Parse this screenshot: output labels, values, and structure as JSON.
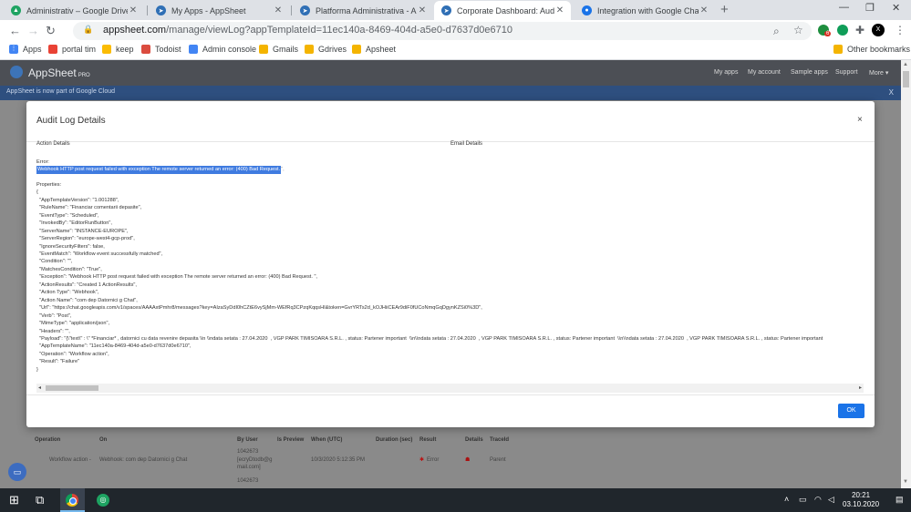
{
  "tabs": [
    {
      "title": "Administrativ – Google Drive",
      "icon": "google-drive-icon",
      "color": "#1fa463"
    },
    {
      "title": "My Apps - AppSheet",
      "icon": "appsheet-icon",
      "color": "#2f6fb5"
    },
    {
      "title": "Platforma Administrativa - AppSh",
      "icon": "appsheet-icon",
      "color": "#2f6fb5"
    },
    {
      "title": "Corporate Dashboard: Audit Log",
      "icon": "appsheet-icon",
      "color": "#2f6fb5"
    },
    {
      "title": "Integration with Google Chat - H",
      "icon": "chat-icon",
      "color": "#1a73e8"
    }
  ],
  "toolbar": {
    "url_host": "appsheet.com",
    "url_path": "/manage/viewLog?appTemplateId=11ec140a-8469-404d-a5e0-d7637d0e6710",
    "ext_badge": "6"
  },
  "bookmarks": [
    {
      "label": "Apps",
      "color": "#4285f4"
    },
    {
      "label": "portal tim",
      "color": "#e94235"
    },
    {
      "label": "keep",
      "color": "#fbbc04"
    },
    {
      "label": "Todoist",
      "color": "#db4c3f"
    },
    {
      "label": "Admin console",
      "color": "#4285f4"
    },
    {
      "label": "Gmails",
      "color": "#f4b400"
    },
    {
      "label": "Gdrives",
      "color": "#f4b400"
    },
    {
      "label": "Apsheet",
      "color": "#f4b400"
    },
    {
      "label": "Other bookmarks",
      "color": "#f4b400"
    }
  ],
  "app": {
    "brand": "AppSheet",
    "brand_suffix": "PRO",
    "nav": [
      "My apps",
      "My account",
      "Sample apps",
      "Support",
      "More ▾"
    ],
    "banner": "AppSheet is now part of Google Cloud",
    "banner_close": "X"
  },
  "bgtable": {
    "headers": [
      "Operation",
      "On",
      "By User",
      "Is Preview",
      "When (UTC)",
      "Duration (sec)",
      "Result",
      "Details",
      "TraceId"
    ],
    "row": {
      "operation": "Workflow action -",
      "on": "Webhook: com dep Datornici g Chat",
      "user_id": "1042673",
      "user_email": "[ecryDtodb@g",
      "user_email2": "mail.com]",
      "when": "10/3/2020 5:12:35 PM",
      "result": "Error",
      "traceid": "Parent"
    },
    "next_user_id": "1042673"
  },
  "modal": {
    "title": "Audit Log Details",
    "close": "×",
    "action_details": "Action Details",
    "email_details": "Email Details",
    "error_label": "Error:",
    "error_text": "Webhook HTTP post request failed with exception The remote server returned an error: (400) Bad Request.",
    "error_tail": "\",",
    "properties_label": "Properties:",
    "properties": "{\n  \"AppTemplateVersion\": \"1.001288\",\n  \"RuleName\": \"Financiar comentarii depasite\",\n  \"EventType\": \"Scheduled\",\n  \"InvokedBy\": \"EditorRunButton\",\n  \"ServerName\": \"INSTANCE-EUROPE\",\n  \"ServerRegion\": \"europe-west4-gcp-prod\",\n  \"IgnoreSecurityFilters\": false,\n  \"EventMatch\": \"Workflow event successfully matched\",\n  \"Condition\": \"\",\n  \"MatchesCondition\": \"True\",\n  \"Exception\": \"Webhook HTTP post request failed with exception The remote server returned an error: (400) Bad Request. \",\n  \"ActionResults\": \"Created 1 ActionResults\",\n  \"Action Type\": \"Webhook\",\n  \"Action Name\": \"com dep Datornici g Chat\",\n  \"Url\": \"https://chat.googleapis.com/v1/spaces/AAAAxtPmhr8/messages?key=AIzaSyDdI0hCZtE6vySjMm-WEfRq3CPzqKqqsHI&token=GvrYRTs2d_kOJHiiCEAr9diF0fUCoNmqGqDgynKZSi0%3D\",\n  \"Verb\": \"Post\",\n  \"MimeType\": \"application/json\",\n  \"Headers\": \"\",\n  \"Payload\": \"{\\\"text\\\" : \\\" *Financiar* , datornici cu data revenire depasita \\\\n \\\\ndata setata : 27.04.2020  , VGP PARK TIMISOARA S.R.L. , status: Partener important  \\\\n\\\\ndata setata : 27.04.2020  , VGP PARK TIMISOARA S.R.L. , status: Partener important  \\\\n\\\\ndata setata : 27.04.2020  , VGP PARK TIMISOARA S.R.L. , status: Partener important\n  \"AppTemplateName\": \"11ec140a-8469-404d-a5e0-d7637d0e6710\",\n  \"Operation\": \"Workflow action\",\n  \"Result\": \"Failure\"\n}",
    "ok_label": "OK"
  },
  "taskbar": {
    "time": "20:21",
    "date": "03.10.2020"
  }
}
